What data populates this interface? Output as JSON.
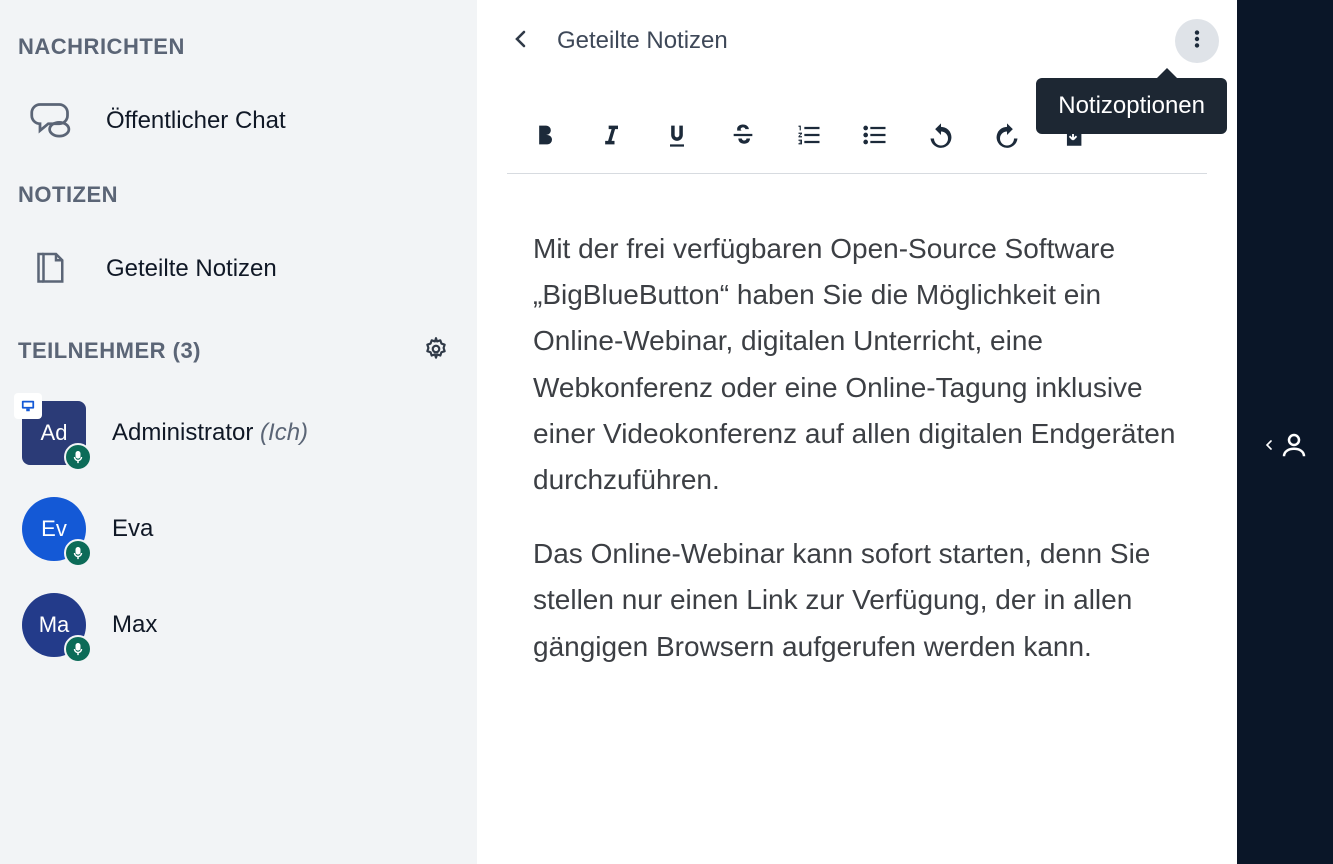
{
  "sidebar": {
    "messages_title": "NACHRICHTEN",
    "public_chat_label": "Öffentlicher Chat",
    "notes_title": "NOTIZEN",
    "shared_notes_label": "Geteilte Notizen",
    "participants_title": "TEILNEHMER (3)",
    "participants": [
      {
        "initials": "Ad",
        "name": "Administrator",
        "me_suffix": "(Ich)"
      },
      {
        "initials": "Ev",
        "name": "Eva",
        "me_suffix": ""
      },
      {
        "initials": "Ma",
        "name": "Max",
        "me_suffix": ""
      }
    ]
  },
  "panel": {
    "title": "Geteilte Notizen",
    "tooltip": "Notizoptionen"
  },
  "note_text": {
    "p1": "Mit der frei verfügbaren Open-Source Software „BigBlueButton“ haben Sie die Möglichkeit ein Online-Webinar, digitalen Unterricht, eine Webkonferenz oder eine Online-Tagung inklusive einer Videokonferenz auf allen digitalen Endgeräten durchzuführen.",
    "p2": "Das Online-Webinar kann sofort starten, denn Sie stellen nur einen Link zur Verfügung, der in allen gängigen Browsern aufgerufen werden kann."
  }
}
